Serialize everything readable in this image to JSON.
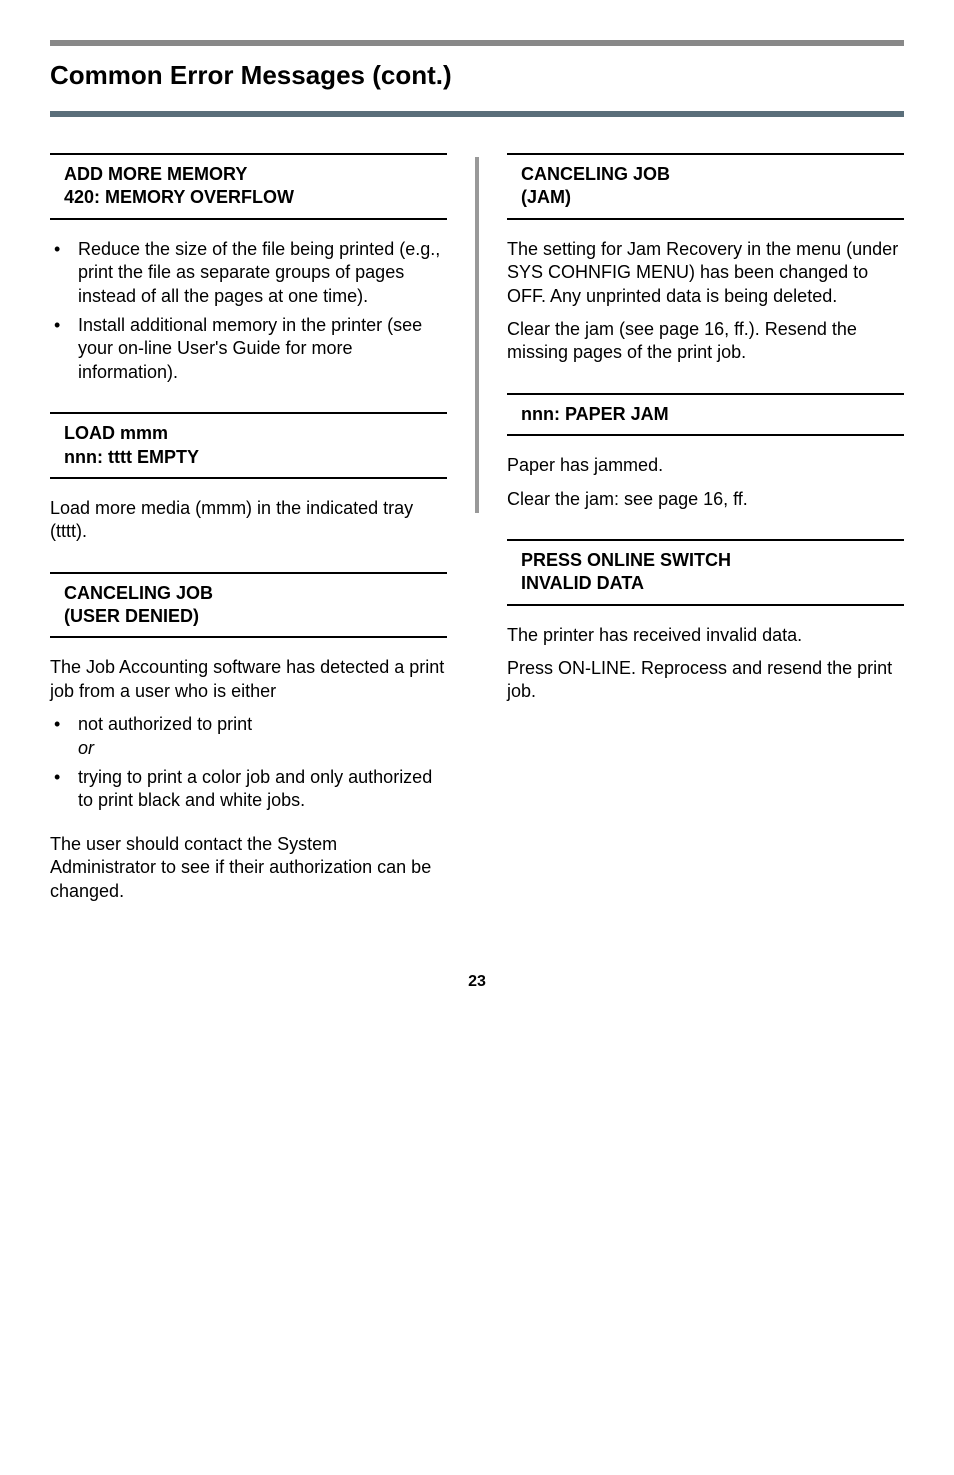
{
  "page_title": "Common Error Messages (cont.)",
  "left": {
    "sec1": {
      "head_l1": "ADD MORE MEMORY",
      "head_l2": "420: MEMORY OVERFLOW",
      "bullet1": "Reduce the size of the file being printed (e.g., print the file as separate groups of pages instead of all the pages at one time).",
      "bullet2": "Install additional memory in the printer (see your on-line User's Guide for more information)."
    },
    "sec2": {
      "head_l1": "LOAD mmm",
      "head_l2": "nnn: tttt EMPTY",
      "para": "Load more media (mmm) in the indicated tray (tttt)."
    },
    "sec3": {
      "head_l1": "CANCELING JOB",
      "head_l2": "(USER DENIED)",
      "para": "The Job Accounting software has detected a print job from a user who is either",
      "bullet1a": "not authorized to print",
      "bullet1b": "or",
      "bullet2": "trying to print a color job and only authorized to print black and white jobs.",
      "para2": "The user should contact the System Administrator to see if their authorization can be changed."
    }
  },
  "right": {
    "sec1": {
      "head_l1": "CANCELING JOB",
      "head_l2": "(JAM)",
      "para1": "The setting for Jam Recovery in the menu (under SYS COHNFIG MENU) has been changed to OFF. Any unprinted data is being deleted.",
      "para2": "Clear the jam (see page 16, ff.). Resend the missing pages of the print job."
    },
    "sec2": {
      "head": "nnn: PAPER JAM",
      "para1": "Paper has jammed.",
      "para2": "Clear the jam: see page 16, ff."
    },
    "sec3": {
      "head_l1": "PRESS ONLINE SWITCH",
      "head_l2": "INVALID DATA",
      "para1": "The printer has received invalid data.",
      "para2": "Press ON-LINE. Reprocess and resend the print job."
    }
  },
  "page_number": "23"
}
